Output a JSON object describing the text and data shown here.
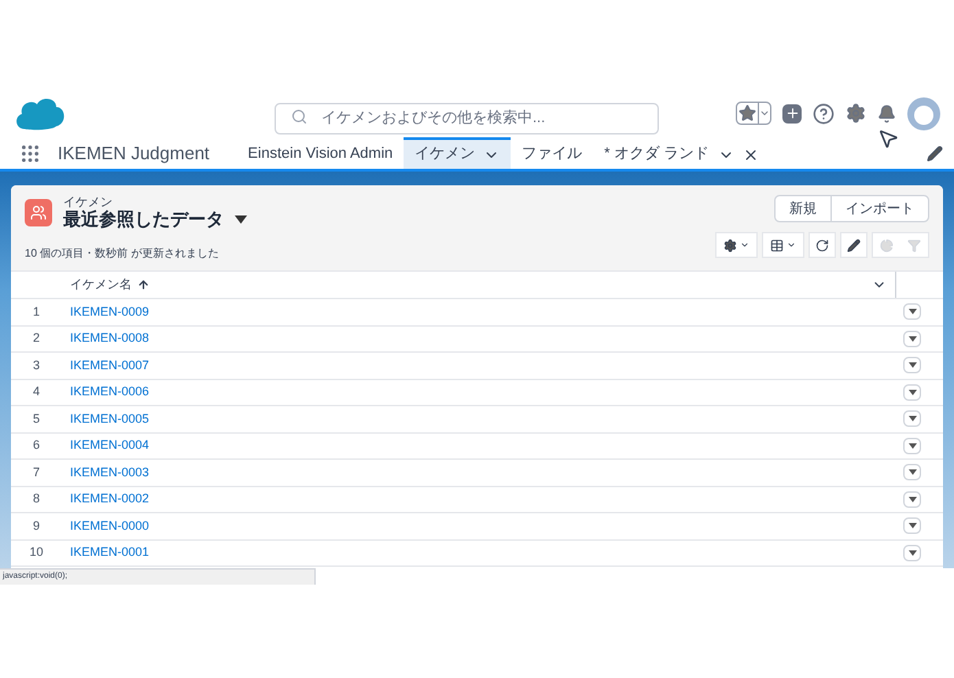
{
  "header": {
    "search": {
      "placeholder": "イケメンおよびその他を検索中..."
    }
  },
  "nav": {
    "app_name": "IKEMEN Judgment",
    "tabs": [
      {
        "label": "Einstein Vision Admin",
        "selected": false,
        "has_menu": false,
        "closable": false
      },
      {
        "label": "イケメン",
        "selected": true,
        "has_menu": true,
        "closable": false
      },
      {
        "label": "ファイル",
        "selected": false,
        "has_menu": false,
        "closable": false
      },
      {
        "label": "* オクダ ランド",
        "selected": false,
        "has_menu": true,
        "closable": true
      }
    ]
  },
  "list_view": {
    "object": "イケメン",
    "title": "最近参照したデータ",
    "status": "10 個の項目・数秒前 が更新されました",
    "buttons": [
      "新規",
      "インポート"
    ],
    "column": "イケメン名",
    "rows": [
      {
        "num": "1",
        "name": "IKEMEN-0009"
      },
      {
        "num": "2",
        "name": "IKEMEN-0008"
      },
      {
        "num": "3",
        "name": "IKEMEN-0007"
      },
      {
        "num": "4",
        "name": "IKEMEN-0006"
      },
      {
        "num": "5",
        "name": "IKEMEN-0005"
      },
      {
        "num": "6",
        "name": "IKEMEN-0004"
      },
      {
        "num": "7",
        "name": "IKEMEN-0003"
      },
      {
        "num": "8",
        "name": "IKEMEN-0002"
      },
      {
        "num": "9",
        "name": "IKEMEN-0000"
      },
      {
        "num": "10",
        "name": "IKEMEN-0001"
      }
    ]
  },
  "status_bar": "javascript:void(0);"
}
